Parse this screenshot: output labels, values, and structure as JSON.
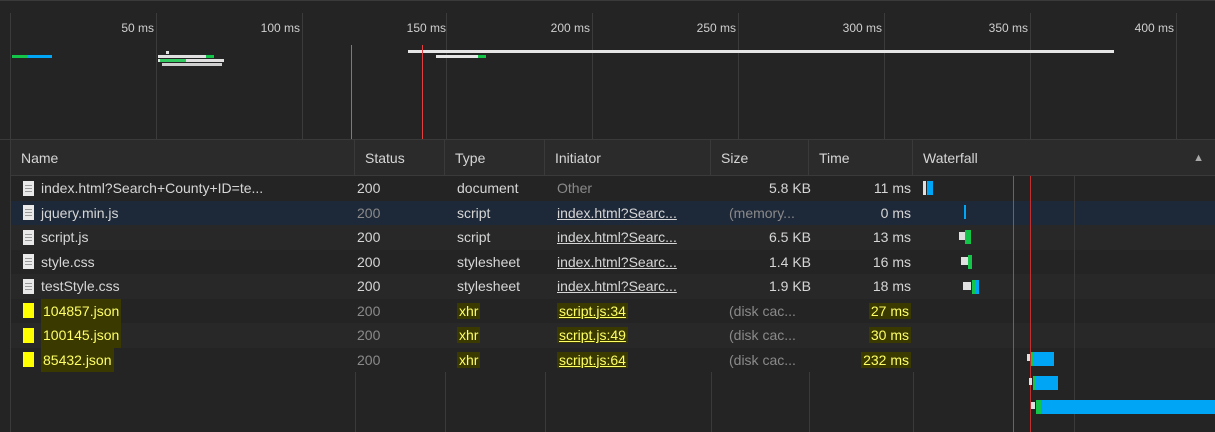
{
  "overview": {
    "ticks": [
      "50 ms",
      "100 ms",
      "150 ms",
      "200 ms",
      "250 ms",
      "300 ms",
      "350 ms",
      "400 ms"
    ]
  },
  "columns": {
    "name": "Name",
    "status": "Status",
    "type": "Type",
    "initiator": "Initiator",
    "size": "Size",
    "time": "Time",
    "waterfall": "Waterfall",
    "sort_icon": "triangle-up-icon"
  },
  "rows": [
    {
      "name": "index.html?Search+County+ID=te...",
      "status": "200",
      "type": "document",
      "initiator": "Other",
      "size": "5.8 KB",
      "time": "11 ms",
      "icon": "file-icon",
      "style": "normal"
    },
    {
      "name": "jquery.min.js",
      "status": "200",
      "type": "script",
      "initiator": "index.html?Searc...",
      "size": "(memory...",
      "time": "0 ms",
      "icon": "file-icon",
      "style": "selected"
    },
    {
      "name": "script.js",
      "status": "200",
      "type": "script",
      "initiator": "index.html?Searc...",
      "size": "6.5 KB",
      "time": "13 ms",
      "icon": "file-icon",
      "style": "normal"
    },
    {
      "name": "style.css",
      "status": "200",
      "type": "stylesheet",
      "initiator": "index.html?Searc...",
      "size": "1.4 KB",
      "time": "16 ms",
      "icon": "file-icon",
      "style": "normal"
    },
    {
      "name": "testStyle.css",
      "status": "200",
      "type": "stylesheet",
      "initiator": "index.html?Searc...",
      "size": "1.9 KB",
      "time": "18 ms",
      "icon": "file-icon",
      "style": "normal"
    },
    {
      "name": "104857.json",
      "status": "200",
      "type": "xhr",
      "initiator": "script.js:34",
      "size": "(disk cac...",
      "time": "27 ms",
      "icon": "json-icon",
      "style": "highlight"
    },
    {
      "name": "100145.json",
      "status": "200",
      "type": "xhr",
      "initiator": "script.js:49",
      "size": "(disk cac...",
      "time": "30 ms",
      "icon": "json-icon",
      "style": "highlight"
    },
    {
      "name": "85432.json",
      "status": "200",
      "type": "xhr",
      "initiator": "script.js:64",
      "size": "(disk cac...",
      "time": "232 ms",
      "icon": "json-icon",
      "style": "highlight"
    }
  ],
  "colors": {
    "blue": "#00a5f5",
    "green": "#13c64a",
    "red_line": "#e04040",
    "blue_line": "#2f6fc2",
    "selected_row": "#1d2838"
  }
}
